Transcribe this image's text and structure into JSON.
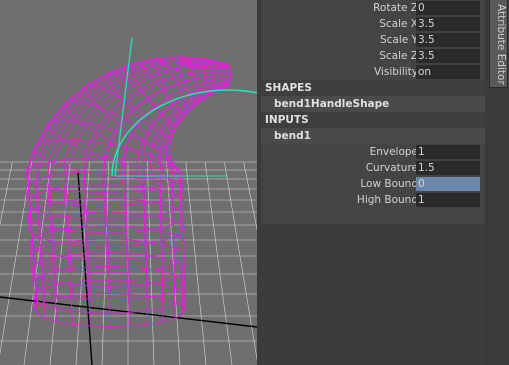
{
  "attribute_editor": {
    "transform_rows": [
      {
        "label": "Rotate Z",
        "value": "0"
      },
      {
        "label": "Scale X",
        "value": "3.5"
      },
      {
        "label": "Scale Y",
        "value": "3.5"
      },
      {
        "label": "Scale Z",
        "value": "3.5"
      },
      {
        "label": "Visibility",
        "value": "on"
      }
    ],
    "shapes_header": "SHAPES",
    "shape_node": "bend1HandleShape",
    "inputs_header": "INPUTS",
    "input_node": "bend1",
    "input_rows": [
      {
        "label": "Envelope",
        "value": "1"
      },
      {
        "label": "Curvature",
        "value": "1.5"
      },
      {
        "label": "Low Bound",
        "value": "0"
      },
      {
        "label": "High Bound",
        "value": "1"
      }
    ]
  },
  "side_tab": {
    "label": "Attribute Editor"
  },
  "colors": {
    "viewport_bg": "#6f6f6f",
    "wireframe": "#e21fe2",
    "handle": "#29e0b4",
    "grid": "#d8d8d8",
    "axis": "#000000",
    "selected_field": "#6a86a8"
  }
}
